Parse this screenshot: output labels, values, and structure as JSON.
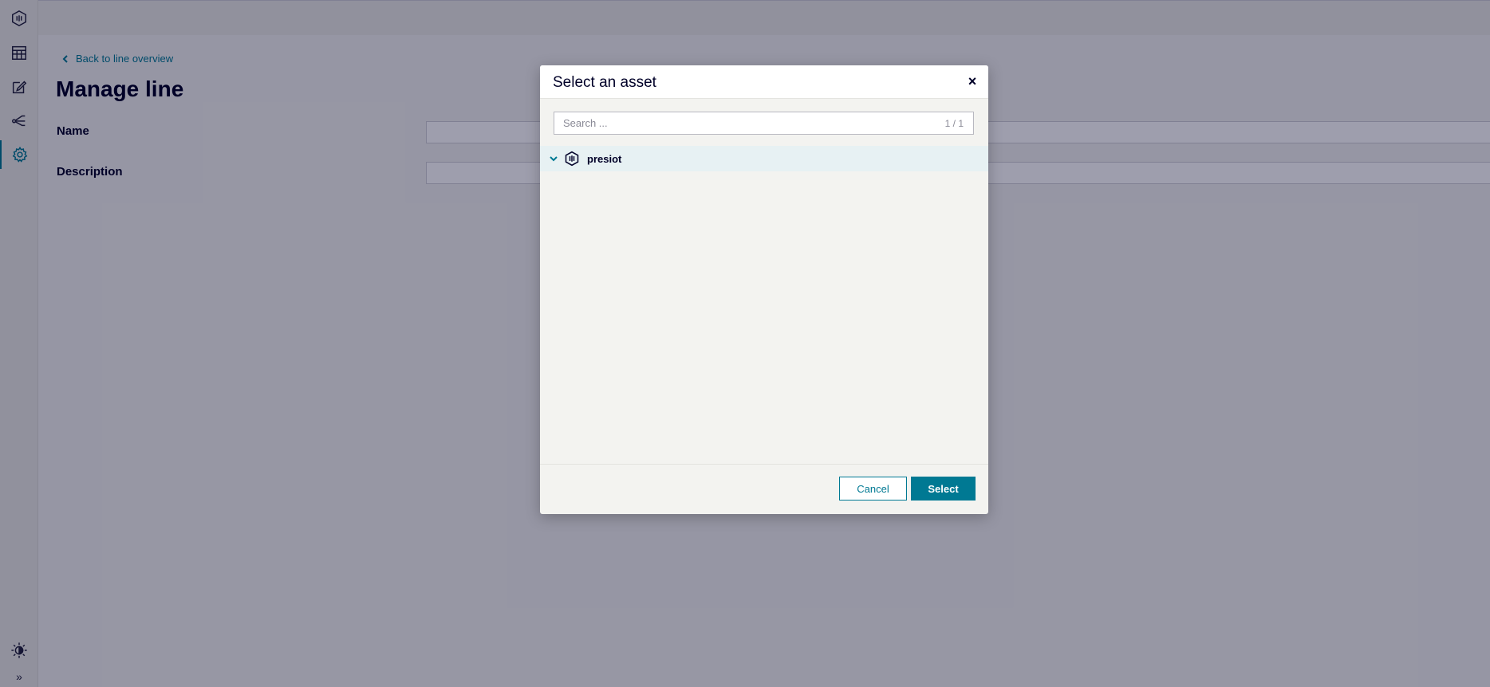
{
  "sidebar": {
    "items": [
      {
        "name": "asset-hub-icon",
        "label": ""
      },
      {
        "name": "calendar-icon",
        "label": ""
      },
      {
        "name": "edit-icon",
        "label": ""
      },
      {
        "name": "share-flow-icon",
        "label": ""
      },
      {
        "name": "gear-icon",
        "label": "",
        "active": true
      }
    ],
    "theme_icon": "brightness-icon",
    "expand_label": "»"
  },
  "main": {
    "back_link": "Back to line overview",
    "title": "Manage line",
    "fields": [
      {
        "label": "Name",
        "value": ""
      },
      {
        "label": "Description",
        "value": ""
      }
    ]
  },
  "modal": {
    "title": "Select an asset",
    "close_label": "×",
    "search": {
      "placeholder": "Search ...",
      "count": "1 / 1"
    },
    "tree": [
      {
        "label": "presiot",
        "expanded": true,
        "icon": "asset-hexagon-icon"
      }
    ],
    "buttons": {
      "cancel": "Cancel",
      "select": "Select"
    }
  },
  "colors": {
    "accent": "#007993",
    "text": "#000028",
    "background": "#f3f3f0",
    "selected_row": "#e7f1f3"
  }
}
